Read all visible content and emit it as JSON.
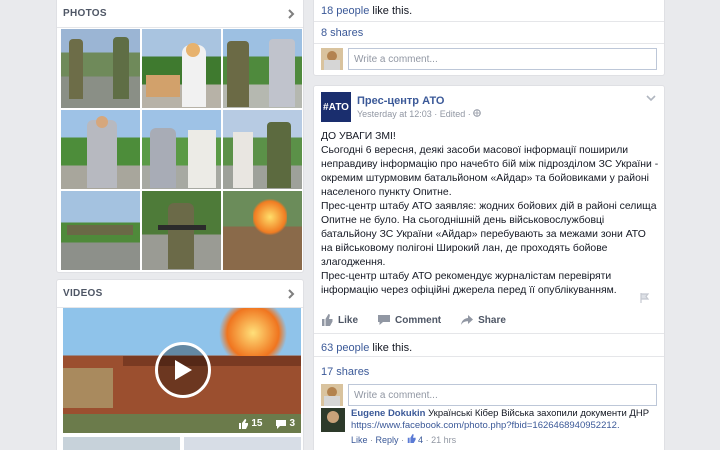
{
  "photos": {
    "title": "PHOTOS",
    "chevron_icon": "chevron-right-icon"
  },
  "videos": {
    "title": "VIDEOS",
    "chevron_icon": "chevron-right-icon",
    "likes_count": "15",
    "comments_count": "3"
  },
  "post1": {
    "likes_text": "18 people",
    "likes_suffix": "like this.",
    "shares_text": "8 shares",
    "comment_placeholder": "Write a comment..."
  },
  "post2": {
    "page_avatar_text": "#АТО",
    "page_name": "Прес-центр АТО",
    "meta_time": "Yesterday at 12:03",
    "meta_edited": "· Edited ·",
    "paragraphs": [
      "ДО УВАГИ ЗМІ!",
      "Сьогодні 6 вересня, деякі засоби масової інформації поширили неправдиву інформацію про начебто бій між підрозділом ЗС України - окремим штурмовим батальйоном «Айдар» та бойовиками у районі населеного пункту Опитне.",
      "Прес-центр штабу АТО заявляє: жодних бойових дій в районі селища Опитне не було. На сьогоднішній день військовослужбовці батальйону ЗС України «Айдар» перебувають за межами зони АТО на військовому полігоні Широкий лан, де проходять бойове злагодження.",
      "Прес-центр штабу АТО рекомендує журналістам перевіряти інформацію через офіційні джерела перед її опублікуванням."
    ],
    "actions": {
      "like": "Like",
      "comment": "Comment",
      "share": "Share"
    },
    "likes_text": "63 people",
    "likes_suffix": "like this.",
    "shares_text": "17 shares",
    "comment_placeholder": "Write a comment...",
    "comment": {
      "author": "Eugene Dokukin",
      "text": "Українські Кібер Війська захопили документи ДНР",
      "link": "https://www.facebook.com/photo.php?fbid=1626468940952212.",
      "like": "Like",
      "reply": "Reply",
      "like_count": "4",
      "time": "21 hrs"
    }
  }
}
